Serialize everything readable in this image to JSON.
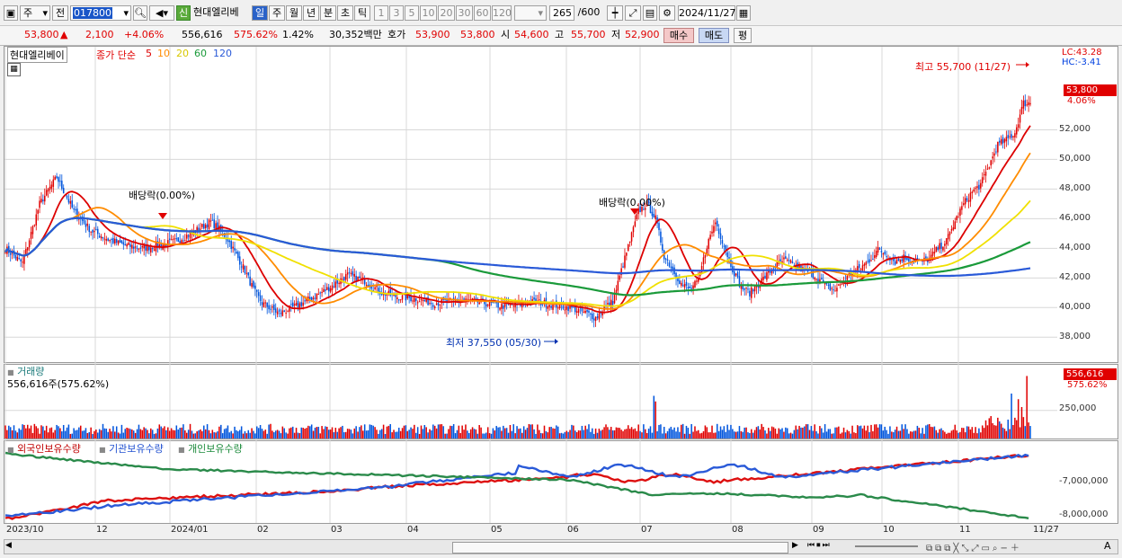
{
  "toolbar": {
    "type_label": "주",
    "prev_label": "전",
    "code_value": "017800",
    "badge_label": "신",
    "stock_name": "현대엘리베",
    "periods": [
      "일",
      "주",
      "월",
      "년",
      "분",
      "초",
      "틱"
    ],
    "tick_units": [
      "1",
      "3",
      "5",
      "10",
      "20",
      "30",
      "60",
      "120"
    ],
    "count_value": "265",
    "count_total": "/600",
    "date_value": "2024/11/27"
  },
  "quote": {
    "price": "53,800",
    "change_arrow": "▲",
    "change": "2,100",
    "change_pct": "+4.06%",
    "volume": "556,616",
    "volume_ratio": "575.62%",
    "turnover": "1.42%",
    "amount": "30,352백만",
    "bid_label": "호가",
    "bid": "53,900",
    "ask": "53,800",
    "open_label": "시",
    "open": "54,600",
    "high_label": "고",
    "high": "55,700",
    "low_label": "저",
    "low": "52,900",
    "buy_button": "매수",
    "sell_button": "매도",
    "eval_button": "평"
  },
  "price_panel": {
    "stock_name": "현대엘리베이",
    "ma_title": "종가 단순",
    "ma_periods": [
      "5",
      "10",
      "20",
      "60",
      "120"
    ],
    "lc": "LC:43.28",
    "hc": "HC:-3.41",
    "last_price": "53,800",
    "last_pct": "4.06%",
    "high_note": "최고 55,700 (11/27)",
    "low_note": "최저 37,550 (05/30)",
    "dividend_note_1": "배당락(0.00%)",
    "dividend_note_2": "배당락(0.00%)"
  },
  "volume_panel": {
    "title": "거래량",
    "current": "556,616주(575.62%)",
    "badge_value": "556,616",
    "badge_pct": "575.62%"
  },
  "holding_panel": {
    "series_labels": [
      "외국인보유수량",
      "기관보유수량",
      "개인보유수량"
    ]
  },
  "colors": {
    "up": "#e00000",
    "down": "#0055dd",
    "ma5": "#dd0000",
    "ma10": "#ff8c00",
    "ma20": "#f0e000",
    "ma60": "#1a9a3a",
    "ma120": "#2a5ad8",
    "grid": "#d8d8d8"
  },
  "chart_data": [
    {
      "type": "candlestick",
      "title": "현대엘리베이",
      "y_ticks": [
        "38,000",
        "40,000",
        "42,000",
        "44,000",
        "46,000",
        "48,000",
        "50,000",
        "52,000"
      ],
      "ylim": [
        36500,
        57000
      ],
      "x_ticks": [
        "2023/10",
        "12",
        "2024/01",
        "02",
        "03",
        "04",
        "05",
        "06",
        "07",
        "08",
        "09",
        "10",
        "11",
        "11/27"
      ],
      "closes_approx": [
        [
          0,
          44000
        ],
        [
          10,
          43000
        ],
        [
          20,
          47000
        ],
        [
          30,
          48800
        ],
        [
          40,
          46500
        ],
        [
          50,
          45200
        ],
        [
          60,
          44600
        ],
        [
          70,
          44200
        ],
        [
          80,
          44000
        ],
        [
          90,
          44200
        ],
        [
          100,
          44500
        ],
        [
          110,
          45100
        ],
        [
          120,
          45800
        ],
        [
          125,
          45300
        ],
        [
          130,
          44600
        ],
        [
          140,
          42500
        ],
        [
          145,
          41200
        ],
        [
          150,
          40300
        ],
        [
          160,
          39600
        ],
        [
          170,
          40100
        ],
        [
          180,
          40700
        ],
        [
          190,
          41400
        ],
        [
          200,
          42200
        ],
        [
          210,
          41800
        ],
        [
          220,
          41000
        ],
        [
          230,
          40700
        ],
        [
          240,
          40600
        ],
        [
          250,
          40300
        ],
        [
          260,
          40400
        ],
        [
          270,
          40500
        ],
        [
          280,
          40300
        ],
        [
          290,
          40100
        ],
        [
          300,
          40200
        ],
        [
          310,
          40400
        ],
        [
          320,
          40200
        ],
        [
          330,
          40000
        ],
        [
          340,
          39600
        ],
        [
          345,
          39300
        ],
        [
          350,
          40000
        ],
        [
          355,
          40400
        ],
        [
          360,
          42500
        ],
        [
          365,
          44500
        ],
        [
          370,
          46500
        ],
        [
          375,
          47000
        ],
        [
          380,
          46000
        ],
        [
          385,
          43500
        ],
        [
          390,
          42600
        ],
        [
          395,
          41600
        ],
        [
          400,
          41200
        ],
        [
          405,
          41800
        ],
        [
          410,
          44200
        ],
        [
          415,
          45800
        ],
        [
          420,
          44200
        ],
        [
          425,
          42600
        ],
        [
          430,
          41400
        ],
        [
          435,
          41000
        ],
        [
          440,
          41600
        ],
        [
          445,
          42200
        ],
        [
          450,
          42800
        ],
        [
          455,
          43200
        ],
        [
          460,
          42900
        ],
        [
          465,
          42600
        ],
        [
          470,
          42400
        ],
        [
          475,
          42000
        ],
        [
          480,
          41400
        ],
        [
          485,
          41200
        ],
        [
          490,
          41800
        ],
        [
          495,
          42400
        ],
        [
          500,
          42700
        ],
        [
          505,
          43200
        ],
        [
          510,
          43900
        ],
        [
          515,
          43600
        ],
        [
          520,
          43100
        ],
        [
          525,
          43400
        ],
        [
          530,
          43200
        ],
        [
          535,
          43100
        ],
        [
          540,
          43300
        ],
        [
          545,
          44000
        ],
        [
          550,
          44500
        ],
        [
          555,
          45800
        ],
        [
          560,
          47000
        ],
        [
          565,
          47800
        ],
        [
          570,
          48300
        ],
        [
          575,
          49600
        ],
        [
          580,
          51000
        ],
        [
          585,
          51300
        ],
        [
          590,
          51800
        ],
        [
          595,
          53800
        ]
      ],
      "series": [
        {
          "name": "5",
          "end_value": 51800
        },
        {
          "name": "10",
          "end_value": 51200
        },
        {
          "name": "20",
          "end_value": 49500
        },
        {
          "name": "60",
          "end_value": 45500
        },
        {
          "name": "120",
          "end_value": 44100
        }
      ],
      "annotations": [
        {
          "text": "최고 55,700 (11/27)",
          "value": 55700
        },
        {
          "text": "최저 37,550 (05/30)",
          "value": 37550
        },
        {
          "text": "배당락(0.00%)"
        },
        {
          "text": "배당락(0.00%)"
        }
      ]
    },
    {
      "type": "bar",
      "title": "거래량",
      "y_ticks": [
        "250,000"
      ],
      "ylim": [
        0,
        600000
      ],
      "last_value": 556616,
      "spikes": [
        [
          379,
          380000
        ],
        [
          380,
          330000
        ],
        [
          588,
          400000
        ],
        [
          592,
          350000
        ],
        [
          594,
          280000
        ],
        [
          597,
          556616
        ]
      ]
    },
    {
      "type": "line",
      "title": "보유수량",
      "y_ticks": [
        "-7,000,000",
        "-8,000,000"
      ],
      "series": [
        {
          "name": "외국인보유수량",
          "color": "red"
        },
        {
          "name": "기관보유수량",
          "color": "blue"
        },
        {
          "name": "개인보유수량",
          "color": "green"
        }
      ]
    }
  ]
}
